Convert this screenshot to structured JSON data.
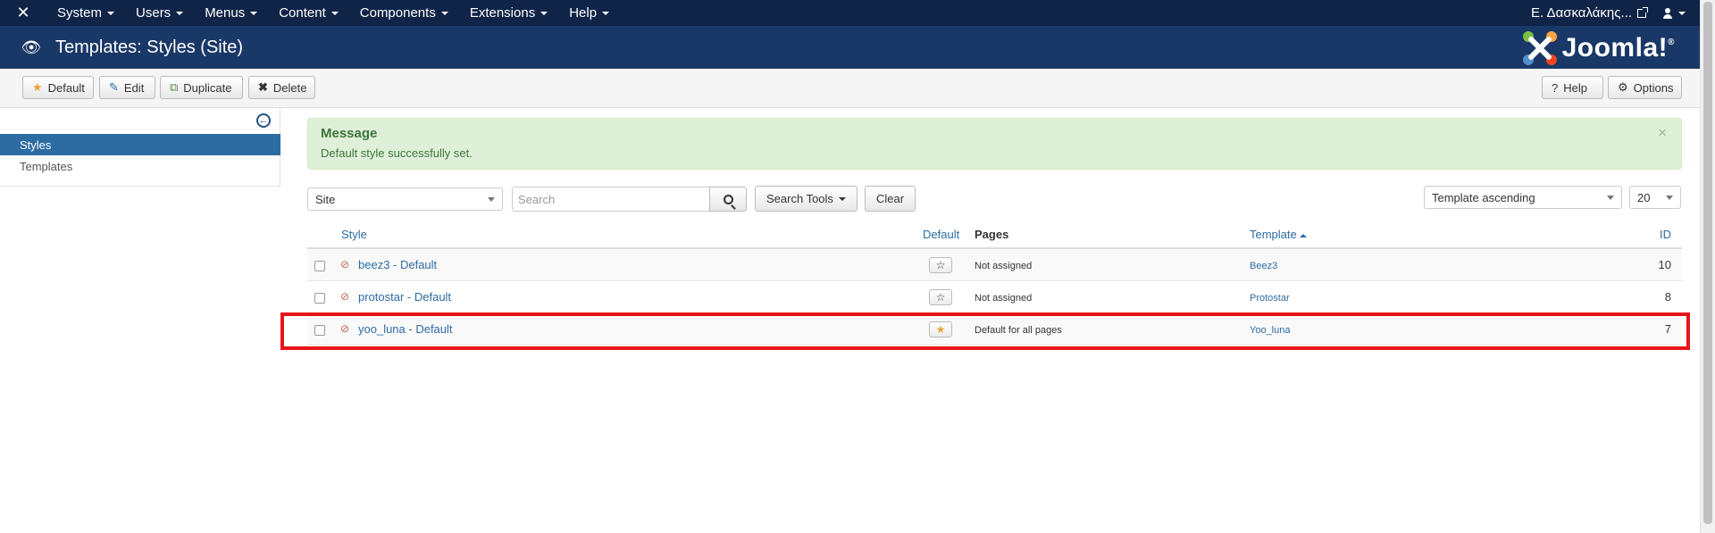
{
  "navbar": {
    "menu": [
      {
        "label": "System"
      },
      {
        "label": "Users"
      },
      {
        "label": "Menus"
      },
      {
        "label": "Content"
      },
      {
        "label": "Components"
      },
      {
        "label": "Extensions"
      },
      {
        "label": "Help"
      }
    ],
    "user_name": "Ε. Δασκαλάκης..."
  },
  "header": {
    "title": "Templates: Styles (Site)",
    "brand": "Joomla!"
  },
  "toolbar": {
    "default_label": "Default",
    "edit_label": "Edit",
    "duplicate_label": "Duplicate",
    "delete_label": "Delete",
    "help_label": "Help",
    "options_label": "Options"
  },
  "sidebar": {
    "items": [
      {
        "label": "Styles",
        "active": true
      },
      {
        "label": "Templates",
        "active": false
      }
    ]
  },
  "message": {
    "title": "Message",
    "text": "Default style successfully set.",
    "close": "×"
  },
  "filters": {
    "client_select": "Site",
    "search_placeholder": "Search",
    "search_tools_label": "Search Tools",
    "clear_label": "Clear",
    "ordering_select": "Template ascending",
    "limit_select": "20"
  },
  "table": {
    "headers": {
      "style": "Style",
      "default": "Default",
      "pages": "Pages",
      "template": "Template",
      "id": "ID"
    },
    "rows": [
      {
        "style": "beez3 - Default",
        "pages": "Not assigned",
        "template": "Beez3",
        "id": "10",
        "is_default": false
      },
      {
        "style": "protostar - Default",
        "pages": "Not assigned",
        "template": "Protostar",
        "id": "8",
        "is_default": false
      },
      {
        "style": "yoo_luna - Default",
        "pages": "Default for all pages",
        "template": "Yoo_luna",
        "id": "7",
        "is_default": true
      }
    ]
  },
  "colors": {
    "navbar_bg": "#0f2447",
    "header_bg": "#1a3867",
    "accent": "#2d6ca2",
    "success_bg": "#dff0d8",
    "highlight": "#e8141b"
  }
}
